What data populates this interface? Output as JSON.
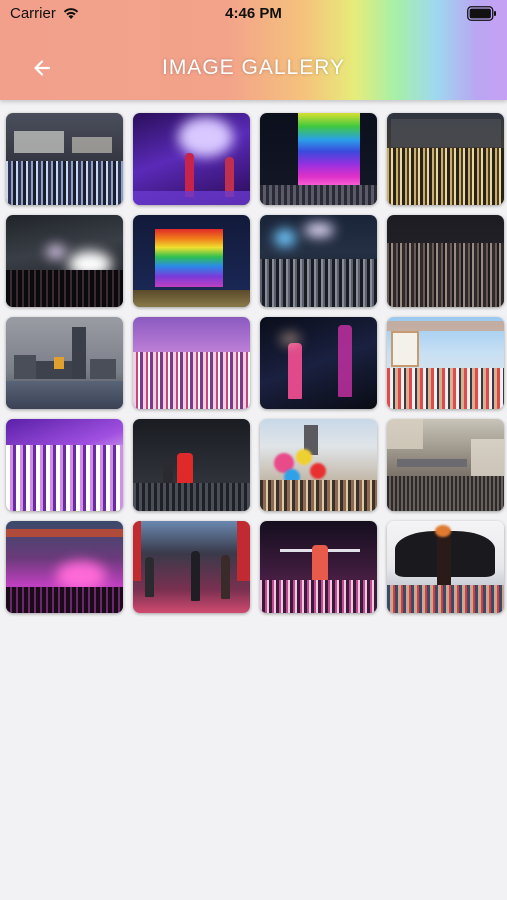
{
  "status_bar": {
    "carrier": "Carrier",
    "time": "4:46 PM"
  },
  "header": {
    "title": "IMAGE GALLERY",
    "back_icon": "back-arrow-icon"
  },
  "gallery": {
    "images": [
      {
        "name": "crowd-night-square"
      },
      {
        "name": "stage-purple-performers"
      },
      {
        "name": "rainbow-lit-building"
      },
      {
        "name": "crowd-evening-plaza"
      },
      {
        "name": "arena-stage-lights"
      },
      {
        "name": "rainbow-hotel-night"
      },
      {
        "name": "crowd-concert-night"
      },
      {
        "name": "crowd-night-festival"
      },
      {
        "name": "city-skyline-dusk"
      },
      {
        "name": "crowd-party-pink"
      },
      {
        "name": "singer-on-stage-dark"
      },
      {
        "name": "promenade-crowd-day"
      },
      {
        "name": "sailors-party-purple"
      },
      {
        "name": "performer-red-dress-stage"
      },
      {
        "name": "balloons-street-crowd"
      },
      {
        "name": "aerial-street-parade"
      },
      {
        "name": "pink-smoke-stage"
      },
      {
        "name": "stage-dancers-red"
      },
      {
        "name": "performer-stage-crowd"
      },
      {
        "name": "black-wings-performer"
      }
    ]
  }
}
